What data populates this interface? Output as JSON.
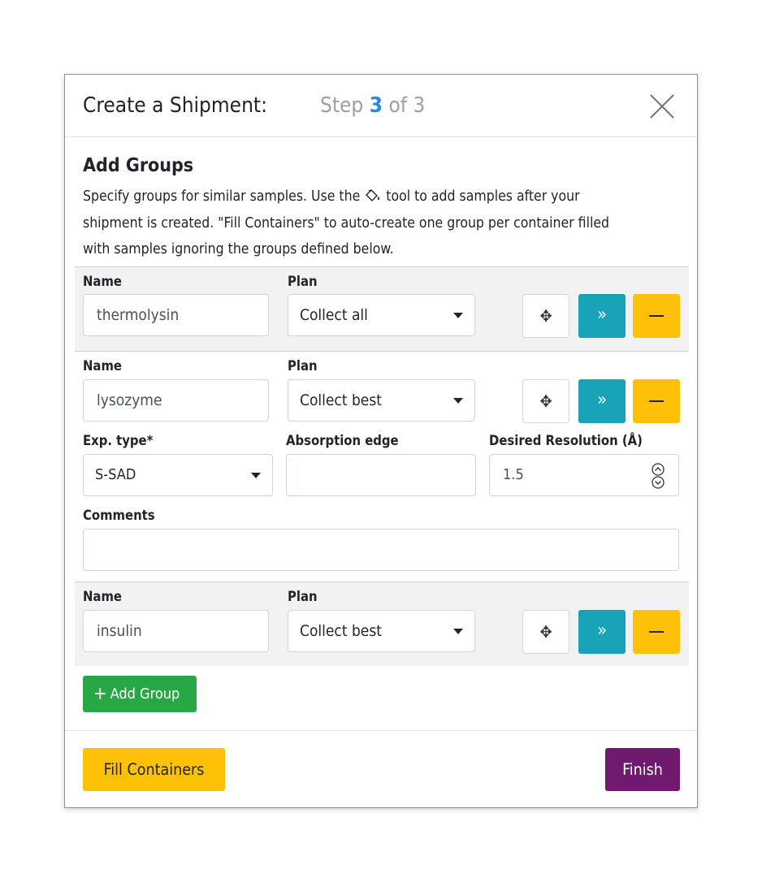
{
  "header": {
    "title": "Create a Shipment:",
    "step_prefix": "Step",
    "step_current": "3",
    "step_suffix": "of 3"
  },
  "intro": {
    "heading": "Add Groups",
    "line1_a": "Specify groups for similar samples. Use the",
    "line1_b": "tool to add samples after your",
    "line2": "shipment is created. \"Fill Containers\" to auto-create one group per container filled",
    "line3": "with samples ignoring the groups defined below."
  },
  "labels": {
    "name": "Name",
    "plan": "Plan",
    "exp_type": "Exp. type*",
    "absorption_edge": "Absorption edge",
    "desired_resolution": "Desired Resolution (Å)",
    "comments": "Comments"
  },
  "groups": [
    {
      "name": "thermolysin",
      "plan": "Collect all"
    },
    {
      "name": "lysozyme",
      "plan": "Collect best",
      "exp_type": "S-SAD",
      "absorption_edge": "",
      "desired_resolution": "1.5",
      "comments": ""
    },
    {
      "name": "insulin",
      "plan": "Collect best"
    }
  ],
  "buttons": {
    "add_group": "Add Group",
    "add_group_icon": "+",
    "fill_containers": "Fill Containers",
    "finish": "Finish",
    "move_icon": "✥",
    "copy_icon": "»"
  },
  "colors": {
    "step_accent": "#2e86de",
    "copy_button": "#17a2b8",
    "remove_button": "#ffc107",
    "add_button": "#28a745",
    "finish_button": "#6f1a6f",
    "group_band": "#f2f2f2"
  }
}
